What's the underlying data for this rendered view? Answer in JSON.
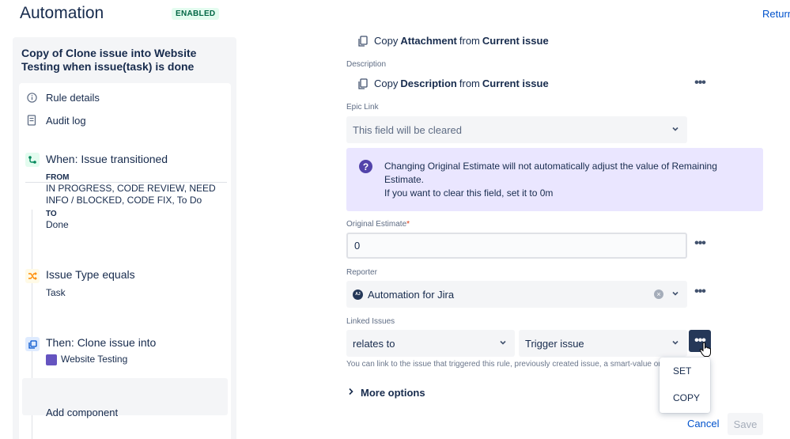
{
  "header": {
    "title": "Automation",
    "status_badge": "ENABLED",
    "return_link": "Return"
  },
  "rule": {
    "title": "Copy of Clone issue into Website Testing when issue(task) is done",
    "meta_items": [
      {
        "label": "Rule details",
        "icon": "info-icon"
      },
      {
        "label": "Audit log",
        "icon": "document-icon"
      }
    ],
    "trigger": {
      "title": "When: Issue transitioned",
      "from_label": "FROM",
      "from_value": "IN PROGRESS, CODE REVIEW, NEED INFO / BLOCKED, CODE FIX, To Do",
      "to_label": "TO",
      "to_value": "Done"
    },
    "condition": {
      "title": "Issue Type equals",
      "value": "Task"
    },
    "action": {
      "title": "Then: Clone issue into",
      "project": "Website Testing"
    },
    "add_component": "Add component"
  },
  "form": {
    "attachment_row": {
      "prefix": "Copy",
      "field": "Attachment",
      "middle": "from",
      "source": "Current issue"
    },
    "description": {
      "label": "Description",
      "prefix": "Copy",
      "field": "Description",
      "middle": "from",
      "source": "Current issue"
    },
    "epic_link": {
      "label": "Epic Link",
      "value": "This field will be cleared"
    },
    "info": {
      "line1": "Changing Original Estimate will not automatically adjust the value of Remaining Estimate.",
      "line2": "If you want to clear this field, set it to 0m"
    },
    "original_estimate": {
      "label": "Original Estimate",
      "required_mark": "*",
      "value": "0"
    },
    "reporter": {
      "label": "Reporter",
      "avatar_initials": "AJ",
      "value": "Automation for Jira"
    },
    "linked_issues": {
      "label": "Linked Issues",
      "link_type": "relates to",
      "target": "Trigger issue",
      "help": "You can link to the issue that triggered this rule, previously created issue, a smart-value or an issue key."
    },
    "more_options": "More options",
    "menu": {
      "items": [
        "SET",
        "COPY"
      ]
    },
    "cancel_label": "Cancel",
    "save_label": "Save",
    "more_glyph": "•••"
  },
  "colors": {
    "accent": "#0052cc",
    "info_bg": "#eae6ff",
    "info_icon": "#5243aa",
    "badge_bg": "#e3fcef",
    "badge_text": "#006644"
  }
}
